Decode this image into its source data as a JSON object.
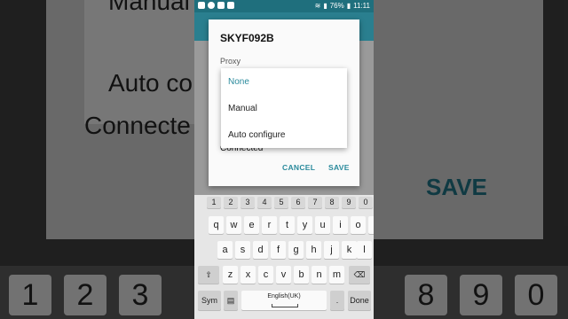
{
  "background": {
    "dialog_text_1": "Manual",
    "dialog_text_2": "Auto co",
    "dialog_text_3": "Connecte",
    "save_label": "SAVE",
    "number_keys": [
      "1",
      "2",
      "3",
      "8",
      "9",
      "0"
    ]
  },
  "status_bar": {
    "battery": "76%",
    "time": "11:11"
  },
  "dialog": {
    "title": "SKYF092B",
    "section_label": "Proxy",
    "connected_label": "Connected",
    "cancel_label": "CANCEL",
    "save_label": "SAVE"
  },
  "dropdown": {
    "options": [
      "None",
      "Manual",
      "Auto configure"
    ],
    "selected": "None"
  },
  "keyboard": {
    "numbers": [
      "1",
      "2",
      "3",
      "4",
      "5",
      "6",
      "7",
      "8",
      "9",
      "0"
    ],
    "row1": [
      "q",
      "w",
      "e",
      "r",
      "t",
      "y",
      "u",
      "i",
      "o",
      "p"
    ],
    "row2": [
      "a",
      "s",
      "d",
      "f",
      "g",
      "h",
      "j",
      "k",
      "l"
    ],
    "row3": [
      "z",
      "x",
      "c",
      "v",
      "b",
      "n",
      "m"
    ],
    "sym_label": "Sym",
    "space_label": "English(UK)",
    "period_label": ".",
    "done_label": "Done"
  },
  "colors": {
    "accent": "#2a8a9c",
    "statusbar": "#1f6f7d"
  }
}
